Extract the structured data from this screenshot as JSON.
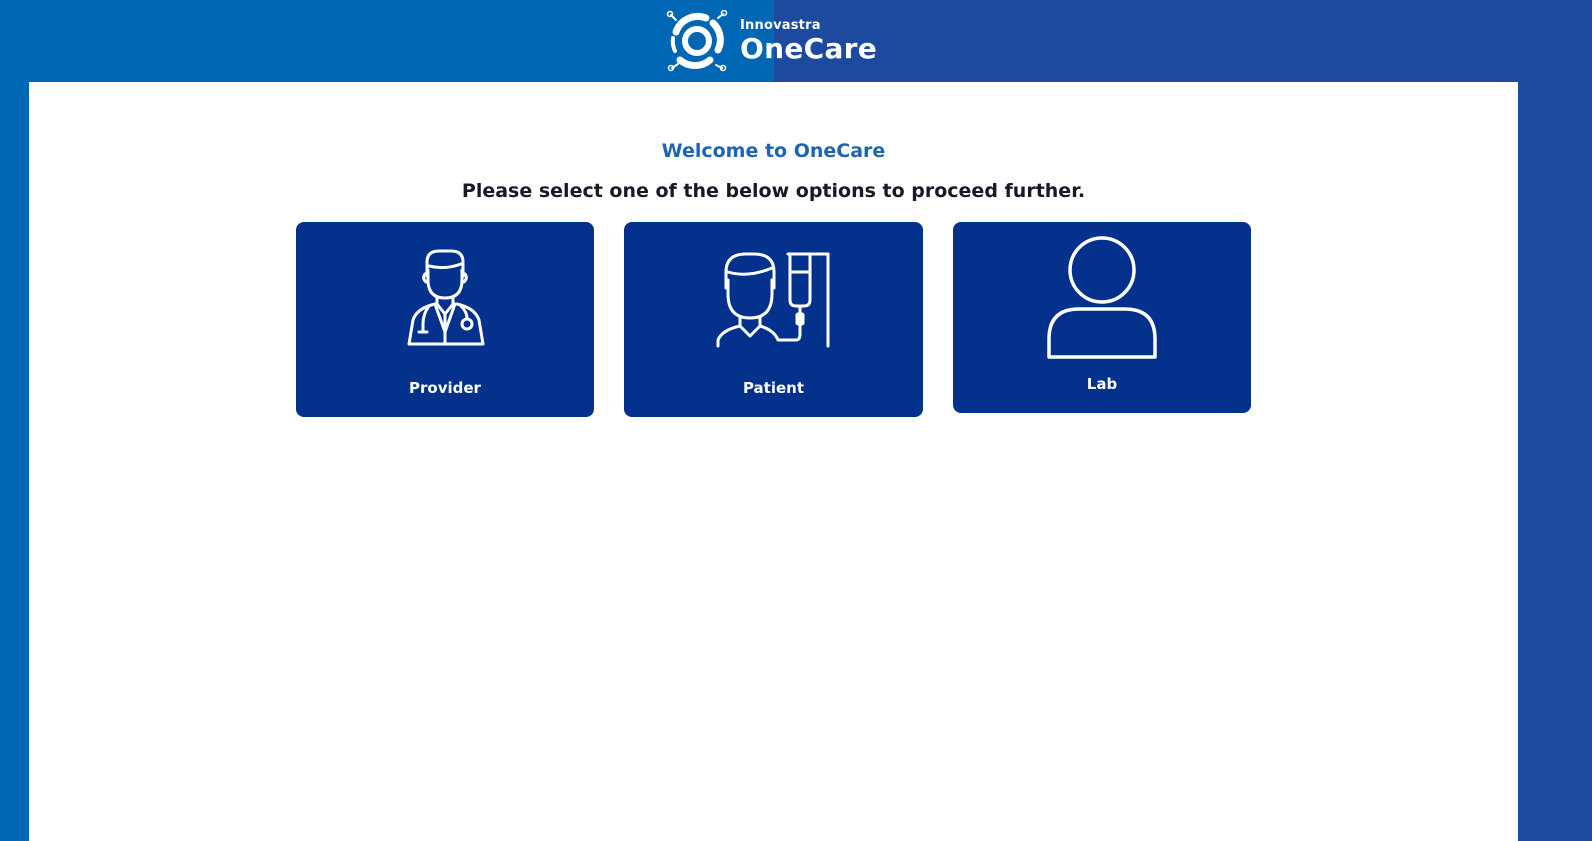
{
  "header": {
    "logo": {
      "company": "Innovastra",
      "product": "OneCare",
      "icon": "onecare-logo-icon"
    },
    "colors": {
      "left_band": "#0067b4",
      "right_band": "#1c4a9e"
    }
  },
  "main": {
    "welcome_title": "Welcome to OneCare",
    "instruction": "Please select one of the below options to proceed further.",
    "options": [
      {
        "label": "Provider",
        "icon": "doctor-icon"
      },
      {
        "label": "Patient",
        "icon": "patient-iv-icon"
      },
      {
        "label": "Lab",
        "icon": "user-icon"
      }
    ],
    "colors": {
      "title": "#1f64b0",
      "card_background": "#03318c"
    }
  }
}
